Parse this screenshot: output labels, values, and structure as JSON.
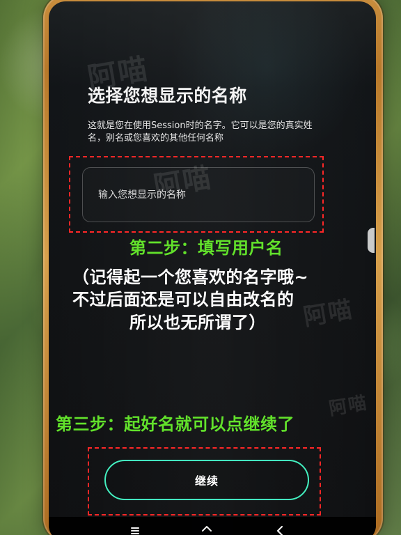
{
  "screen": {
    "title": "选择您想显示的名称",
    "description": "这就是您在使用Session时的名字。它可以是您的真实姓名，别名或您喜欢的其他任何名称",
    "input": {
      "value": "",
      "placeholder": "输入您想显示的名称"
    },
    "button": {
      "label": "继续"
    }
  },
  "annotations": {
    "step_two": "第二步：填写用户名",
    "note_lines": [
      "（记得起一个您喜欢的名字哦~",
      "不过后面还是可以自由改名的",
      "所以也无所谓了）"
    ],
    "step_three": "第三步：起好名就可以点继续了"
  },
  "watermark": {
    "text": "阿喵"
  },
  "icons": {
    "nav_menu": "menu-icon",
    "nav_home": "home-icon",
    "nav_back": "back-icon"
  },
  "colors": {
    "annotation_green": "#62e12b",
    "button_border": "#43f0c0",
    "highlight_red": "#ff2727"
  }
}
